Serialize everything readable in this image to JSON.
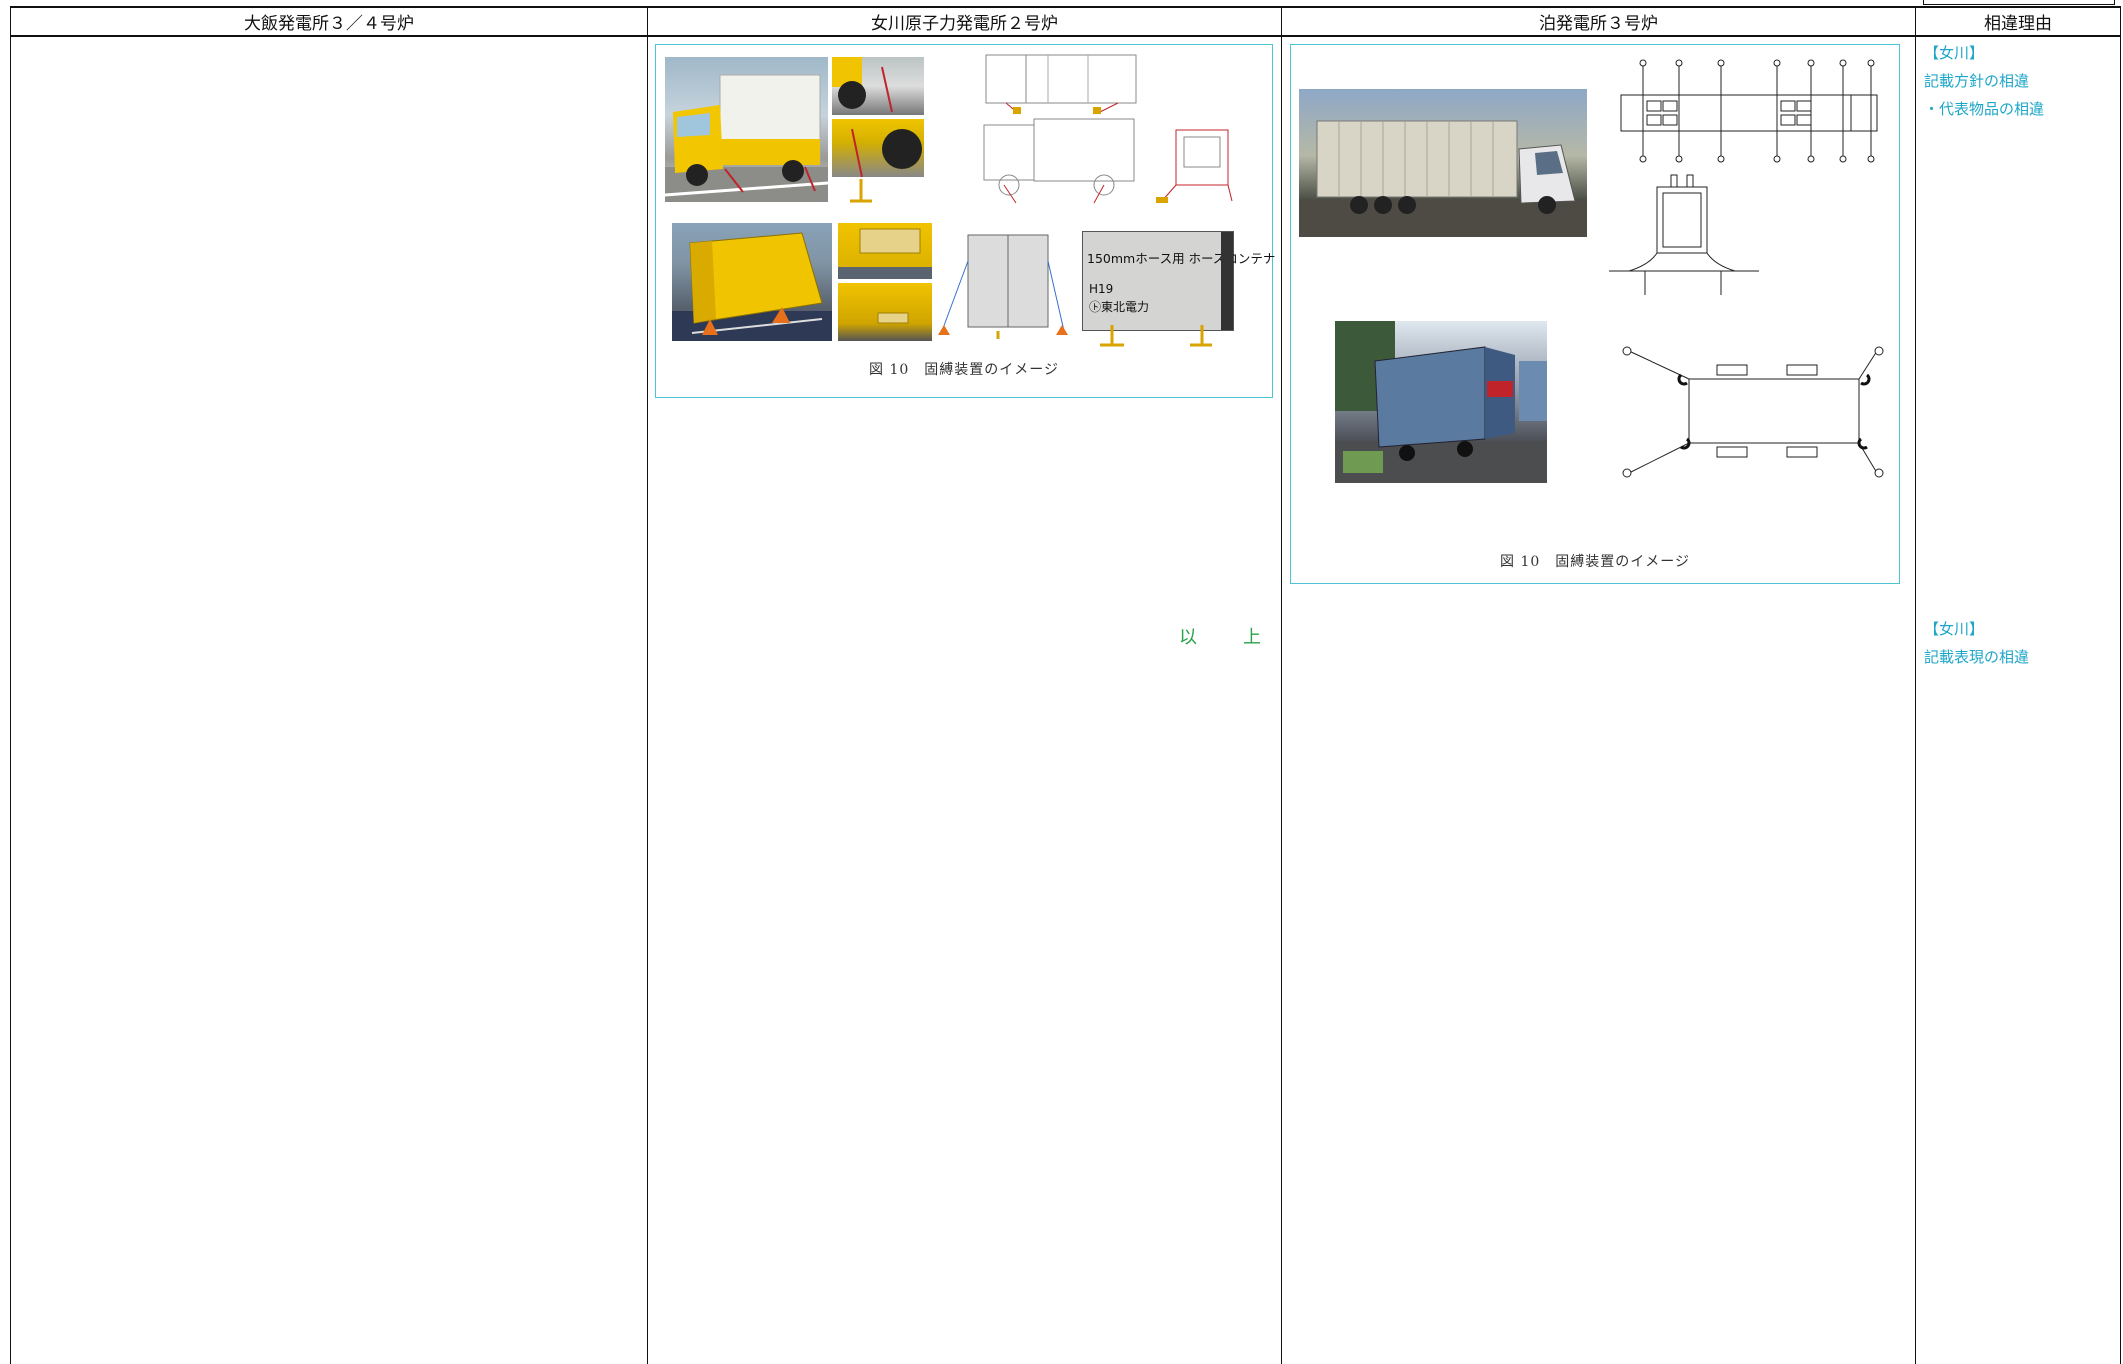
{
  "header": {
    "col1": "大飯発電所３／４号炉",
    "col2": "女川原子力発電所２号炉",
    "col3": "泊発電所３号炉",
    "col4": "相違理由"
  },
  "onagawa": {
    "figure_caption": "図 10　固縛装置のイメージ",
    "container_label_1": "150mmホース用 ホースコンテナ",
    "container_label_2": "H19",
    "container_label_3": "㋣東北電力",
    "end_mark": "以　上"
  },
  "tomari": {
    "figure_caption": "図 10　固縛装置のイメージ"
  },
  "reasons": {
    "block1": {
      "tag": "【女川】",
      "line1": "記載方針の相違",
      "line2": "・代表物品の相違"
    },
    "block2": {
      "tag": "【女川】",
      "line1": "記載表現の相違"
    }
  },
  "colors": {
    "accent_cyan": "#1ea6c9",
    "figure_border": "#4ec3d6",
    "end_mark_green": "#2aa24a"
  }
}
